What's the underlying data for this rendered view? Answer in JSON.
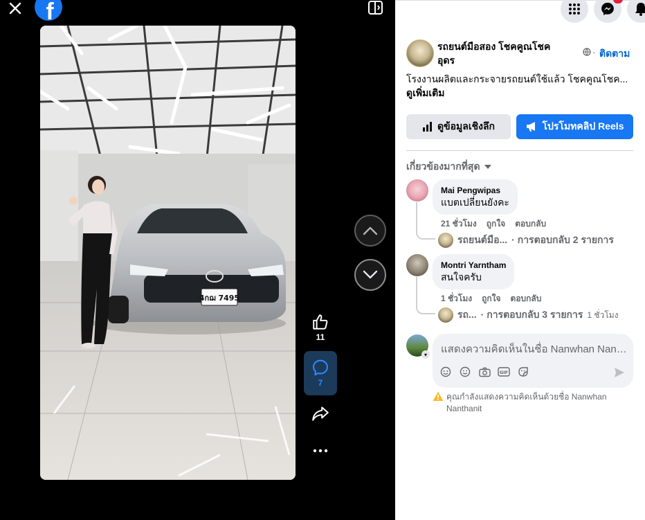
{
  "viewer": {
    "like_count": "11",
    "comment_count": "7",
    "plate": "4กฌ 7495"
  },
  "page": {
    "name": "รถยนต์มือสอง โชคคูณโชค อุดร",
    "follow_label": "ติดตาม",
    "description": "โรงงานผลิตและกระจายรถยนต์ใช้แล้ว โชคคูณโชค...",
    "see_more": "ดูเพิ่มเติม"
  },
  "actions": {
    "insights_label": "ดูข้อมูลเชิงลึก",
    "promote_label": "โปรโมทคลิป Reels"
  },
  "comments": {
    "sort_label": "เกี่ยวข้องมากที่สุด",
    "items": [
      {
        "author": "Mai Pengwipas",
        "text": "แบตเปลี่ยนยังคะ",
        "time": "21 ชั่วโมง",
        "like": "ถูกใจ",
        "reply": "ตอบกลับ",
        "reply_author": "รถยนต์มือ...",
        "reply_summary": "· การตอบกลับ 2 รายการ",
        "reply_time": ""
      },
      {
        "author": "Montri Yarntham",
        "text": "สนใจครับ",
        "time": "1 ชั่วโมง",
        "like": "ถูกใจ",
        "reply": "ตอบกลับ",
        "reply_author": "รถ...",
        "reply_summary": "· การตอบกลับ 3 รายการ",
        "reply_time": "1 ชั่วโมง"
      }
    ]
  },
  "composer": {
    "placeholder": "แสดงความคิดเห็นในชื่อ Nanwhan Nanthanit",
    "notice": "คุณกำลังแสดงความคิดเห็นด้วยชื่อ Nanwhan Nanthanit"
  },
  "colors": {
    "accent": "#1877f2",
    "link": "#0064d1",
    "warning": "#f7b928"
  }
}
